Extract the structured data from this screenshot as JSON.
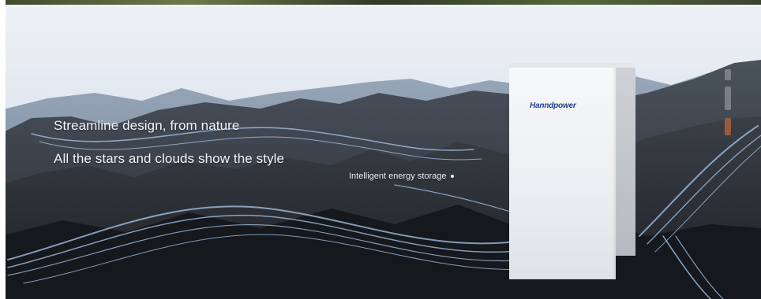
{
  "banner": {
    "headline_1": "Streamline design, from nature",
    "headline_2": "All the stars and clouds show the style",
    "tagline": "Intelligent energy storage",
    "brand": "Hanndpower"
  },
  "colors": {
    "sky_top": "#e9eef4",
    "sky_bottom": "#cdd8e3",
    "mountain_dark": "#2c2f35",
    "mountain_mid": "#4c535e",
    "light_stream": "#a8c6ea",
    "brand_blue": "#1e3f8f",
    "text_white": "#f2f5fa"
  }
}
